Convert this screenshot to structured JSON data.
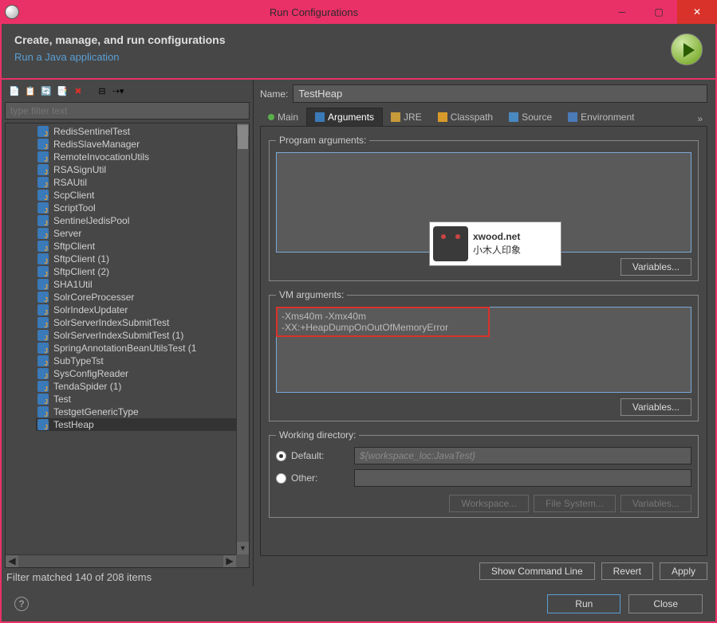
{
  "window": {
    "title": "Run Configurations"
  },
  "header": {
    "heading": "Create, manage, and run configurations",
    "subtitle": "Run a Java application"
  },
  "left": {
    "filter_placeholder": "type filter text",
    "items": [
      "RedisSentinelTest",
      "RedisSlaveManager",
      "RemoteInvocationUtils",
      "RSASignUtil",
      "RSAUtil",
      "ScpClient",
      "ScriptTool",
      "SentinelJedisPool",
      "Server",
      "SftpClient",
      "SftpClient (1)",
      "SftpClient (2)",
      "SHA1Util",
      "SolrCoreProcesser",
      "SolrIndexUpdater",
      "SolrServerIndexSubmitTest",
      "SolrServerIndexSubmitTest (1)",
      "SpringAnnotationBeanUtilsTest (1",
      "SubTypeTst",
      "SysConfigReader",
      "TendaSpider (1)",
      "Test",
      "TestgetGenericType",
      "TestHeap"
    ],
    "status": "Filter matched 140 of 208 items"
  },
  "form": {
    "name_label": "Name:",
    "name_value": "TestHeap",
    "tabs": [
      "Main",
      "Arguments",
      "JRE",
      "Classpath",
      "Source",
      "Environment"
    ],
    "active_tab": "Arguments",
    "program_args": {
      "legend": "Program arguments:",
      "value": "",
      "variables_btn": "Variables..."
    },
    "vm_args": {
      "legend": "VM arguments:",
      "value": "-Xms40m -Xmx40m\n-XX:+HeapDumpOnOutOfMemoryError",
      "variables_btn": "Variables..."
    },
    "workdir": {
      "legend": "Working directory:",
      "default_label": "Default:",
      "default_value": "${workspace_loc:JavaTest}",
      "other_label": "Other:",
      "other_value": "",
      "btns": {
        "workspace": "Workspace...",
        "filesystem": "File System...",
        "variables": "Variables..."
      }
    },
    "bottom": {
      "show_cmd": "Show Command Line",
      "revert": "Revert",
      "apply": "Apply"
    }
  },
  "footer": {
    "run": "Run",
    "close": "Close"
  },
  "watermark": {
    "line1": "xwood.net",
    "line2": "小木人印象"
  }
}
